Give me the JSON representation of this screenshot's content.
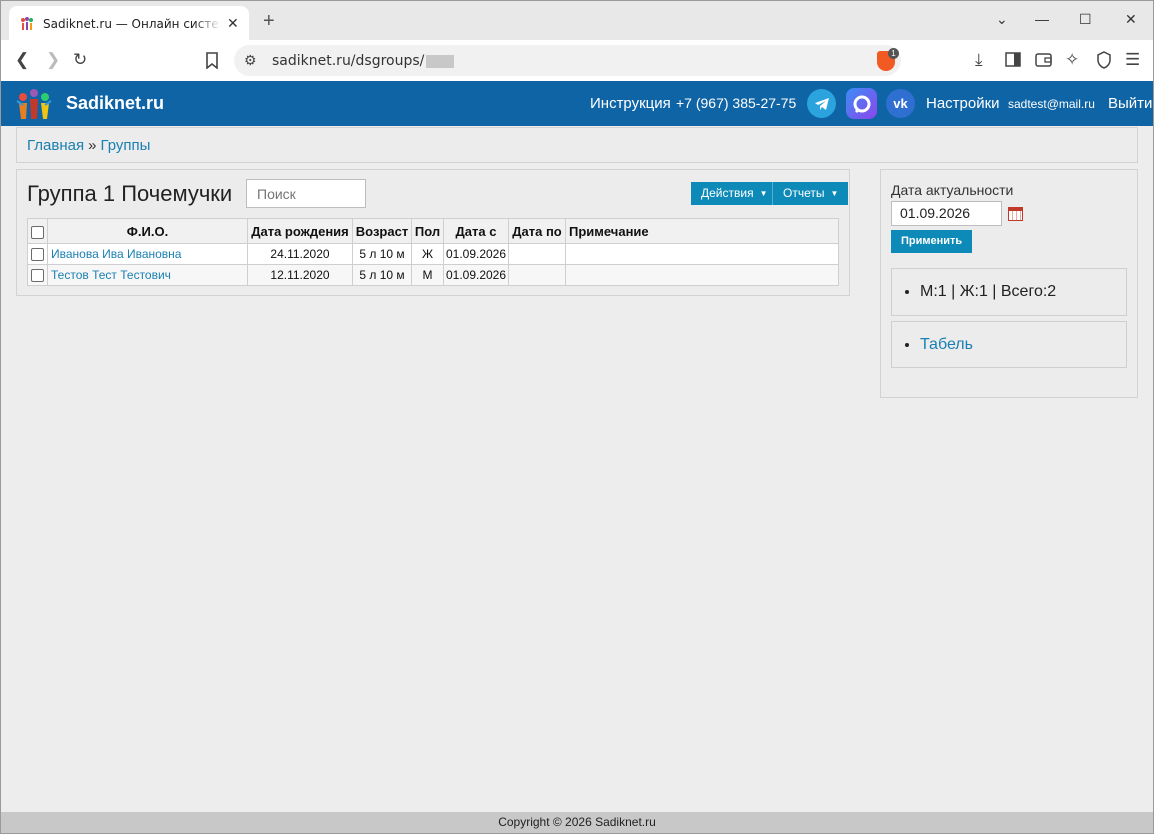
{
  "browser": {
    "tab_title": "Sadiknet.ru — Онлайн система у",
    "url_text": "sadiknet.ru/dsgroups/",
    "brave_badge_count": "1"
  },
  "header": {
    "brand": "Sadiknet.ru",
    "instruction": "Инструкция",
    "phone": "+7 (967) 385-27-75",
    "settings": "Настройки",
    "email": "sadtest@mail.ru",
    "logout": "Выйти"
  },
  "breadcrumb": {
    "home": "Главная",
    "separator": "»",
    "current": "Группы"
  },
  "main": {
    "group_title": "Группа 1 Почемучки",
    "search_placeholder": "Поиск",
    "actions_label": "Действия",
    "reports_label": "Отчеты",
    "columns": [
      "Ф.И.О.",
      "Дата рождения",
      "Возраст",
      "Пол",
      "Дата с",
      "Дата по",
      "Примечание"
    ],
    "rows": [
      {
        "name": "Иванова Ива Ивановна",
        "birth": "24.11.2020",
        "age": "5 л 10 м",
        "sex": "Ж",
        "date_from": "01.09.2026",
        "date_to": "",
        "note": ""
      },
      {
        "name": "Тестов Тест Тестович",
        "birth": "12.11.2020",
        "age": "5 л 10 м",
        "sex": "М",
        "date_from": "01.09.2026",
        "date_to": "",
        "note": ""
      }
    ]
  },
  "sidebar": {
    "date_label": "Дата актуальности",
    "date_value": "01.09.2026",
    "apply_label": "Применить",
    "stats": "М:1 | Ж:1 | Всего:2",
    "tabel_link": "Табель"
  },
  "footer": {
    "copyright": "Copyright © 2026 Sadiknet.ru"
  },
  "colors": {
    "header_bg": "#0f64a5",
    "button_blue": "#0d8ab7",
    "link": "#1a7fb3"
  }
}
